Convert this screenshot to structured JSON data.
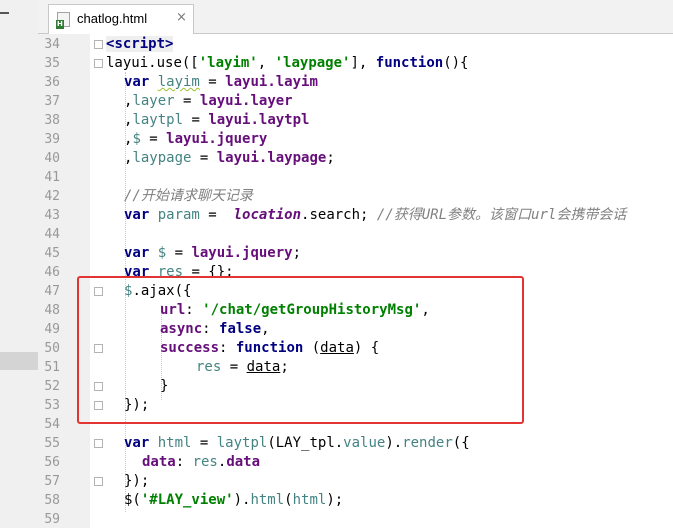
{
  "tab": {
    "filename": "chatlog.html",
    "close_glyph": "×",
    "file_icon": "html-file-icon",
    "icon_letter": "H"
  },
  "colors": {
    "keyword": "#000080",
    "string": "#008000",
    "variable": "#458383",
    "property": "#660e7a",
    "comment": "#808080",
    "highlight_box": "#e33434"
  },
  "line_numbers": [
    "34",
    "35",
    "36",
    "37",
    "38",
    "39",
    "40",
    "41",
    "42",
    "43",
    "44",
    "45",
    "46",
    "47",
    "48",
    "49",
    "50",
    "51",
    "52",
    "53",
    "54",
    "55",
    "56",
    "57",
    "58",
    "59"
  ],
  "code": {
    "l34": {
      "lt": "<",
      "tagname": "script",
      "gt": ">"
    },
    "l35": {
      "a": "layui",
      "b": ".use([",
      "c": "'layim'",
      "d": ", ",
      "e": "'laypage'",
      "f": "], ",
      "g": "function",
      "h": "(){"
    },
    "l36": {
      "a": "var ",
      "b": "layim",
      "c": " = ",
      "d": "layui.layim"
    },
    "l37": {
      "a": ",",
      "b": "layer",
      "c": " = ",
      "d": "layui.layer"
    },
    "l38": {
      "a": ",",
      "b": "laytpl",
      "c": " = ",
      "d": "layui.laytpl"
    },
    "l39": {
      "a": ",",
      "b": "$",
      "c": " = ",
      "d": "layui.jquery"
    },
    "l40": {
      "a": ",",
      "b": "laypage",
      "c": " = ",
      "d": "layui.laypage",
      "e": ";"
    },
    "l42": {
      "a": "//开始请求聊天记录"
    },
    "l43": {
      "a": "var ",
      "b": "param",
      "c": " =  ",
      "d": "location",
      "e": ".search; ",
      "f": "//获得URL参数。该窗口url会携带会话"
    },
    "l45": {
      "a": "var ",
      "b": "$",
      "c": " = ",
      "d": "layui.jquery",
      "e": ";"
    },
    "l46": {
      "a": "var ",
      "b": "res",
      "c": " = {};"
    },
    "l47": {
      "a": "$",
      "b": ".ajax({"
    },
    "l48": {
      "a": "url",
      "b": ": ",
      "c": "'/chat/getGroupHistoryMsg'",
      "d": ","
    },
    "l49": {
      "a": "async",
      "b": ": ",
      "c": "false",
      "d": ","
    },
    "l50": {
      "a": "success",
      "b": ": ",
      "c": "function",
      "d": " (",
      "e": "data",
      "f": ") {"
    },
    "l51": {
      "a": "res",
      "b": " = ",
      "c": "data",
      "d": ";"
    },
    "l52": {
      "a": "}"
    },
    "l53": {
      "a": "});"
    },
    "l55": {
      "a": "var ",
      "b": "html",
      "c": " = ",
      "d": "laytpl",
      "e": "(LAY_tpl.",
      "f": "value",
      "g": ").",
      "h": "render",
      "i": "({"
    },
    "l56": {
      "a": "data",
      "b": ": ",
      "c": "res",
      "d": ".",
      "e": "data"
    },
    "l57": {
      "a": "});"
    },
    "l58": {
      "a": "$(",
      "b": "'#LAY_view'",
      "c": ").",
      "d": "html",
      "e": "(",
      "f": "html",
      "g": ");"
    }
  }
}
